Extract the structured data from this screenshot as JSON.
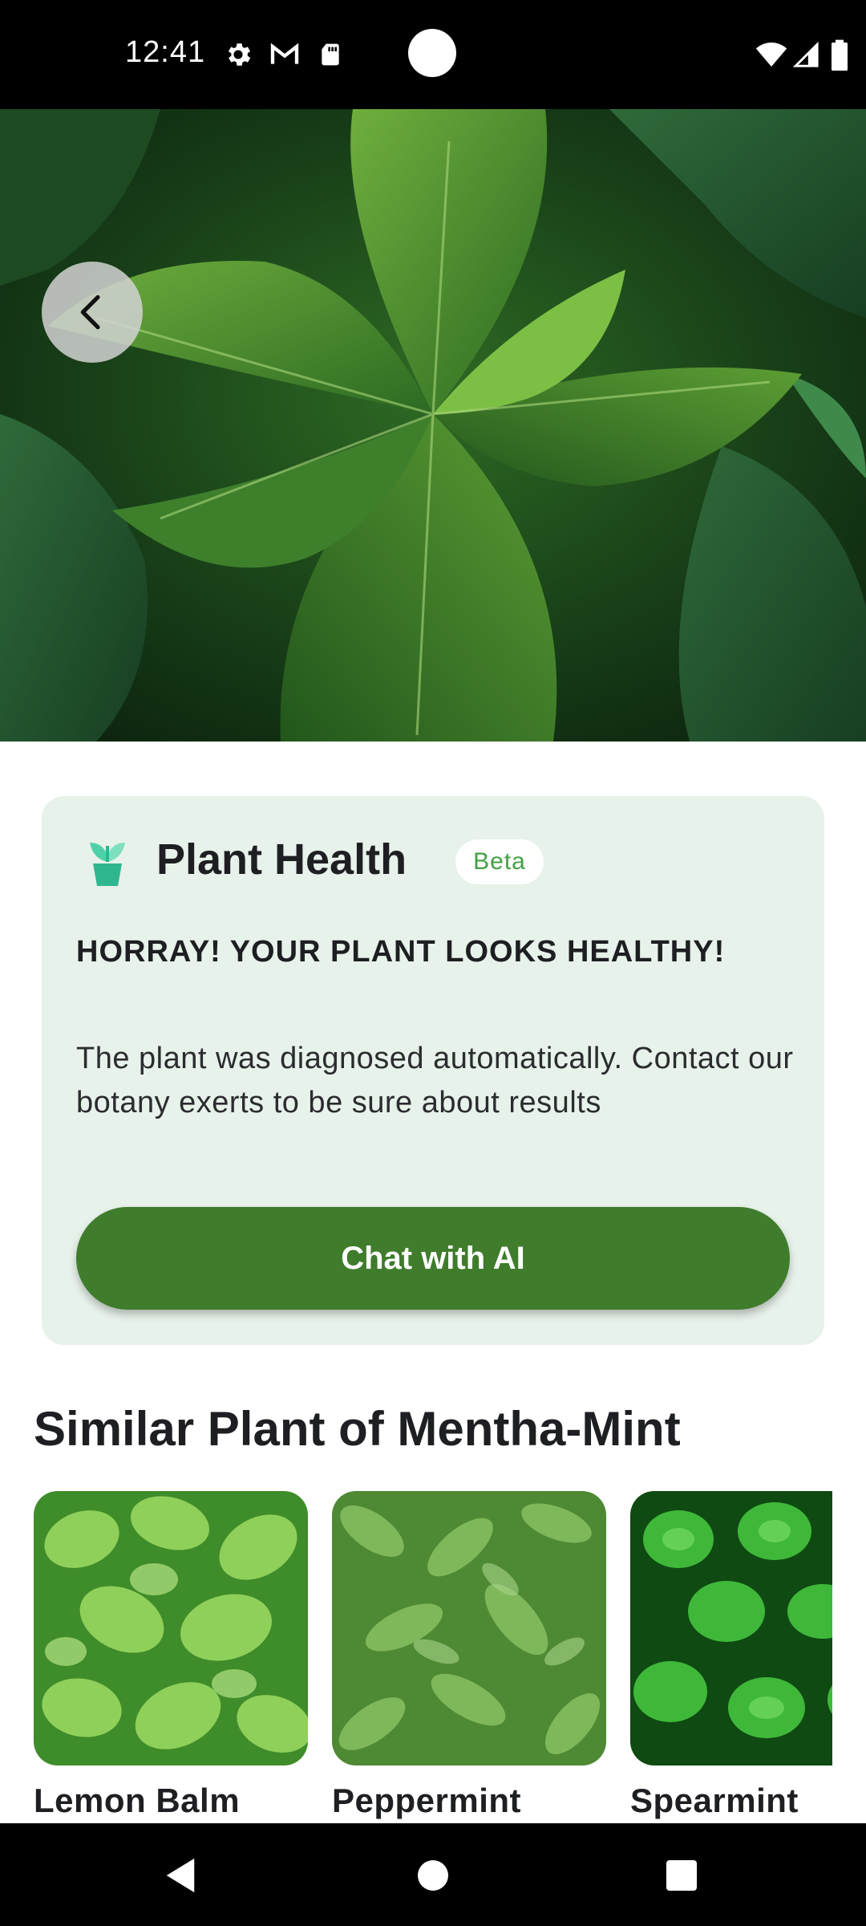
{
  "status_bar": {
    "time": "12:41",
    "icons": [
      "settings-icon",
      "gmail-icon",
      "sd-card-icon",
      "wifi-icon",
      "cellular-signal-icon",
      "battery-icon"
    ]
  },
  "hero": {
    "image": "nettle-plant-photo",
    "back_icon": "chevron-left-icon"
  },
  "health_card": {
    "icon": "potted-plant-icon",
    "title": "Plant Health",
    "badge": "Beta",
    "headline": "HORRAY! YOUR PLANT LOOKS HEALTHY!",
    "description": "The plant was diagnosed automatically. Contact our botany exerts to be sure about results",
    "button_label": "Chat with AI",
    "colors": {
      "background": "#e7f2ea",
      "button": "#3f7c2c",
      "badge_text": "#43a047"
    }
  },
  "similar": {
    "title": "Similar Plant of Mentha-Mint",
    "items": [
      {
        "name": "Lemon Balm",
        "image": "lemon-balm-photo"
      },
      {
        "name": "Peppermint",
        "image": "peppermint-photo"
      },
      {
        "name": "Spearmint",
        "image": "spearmint-photo"
      }
    ]
  },
  "nav_bar": {
    "icons": [
      "back-triangle-icon",
      "home-circle-icon",
      "recents-square-icon"
    ]
  }
}
